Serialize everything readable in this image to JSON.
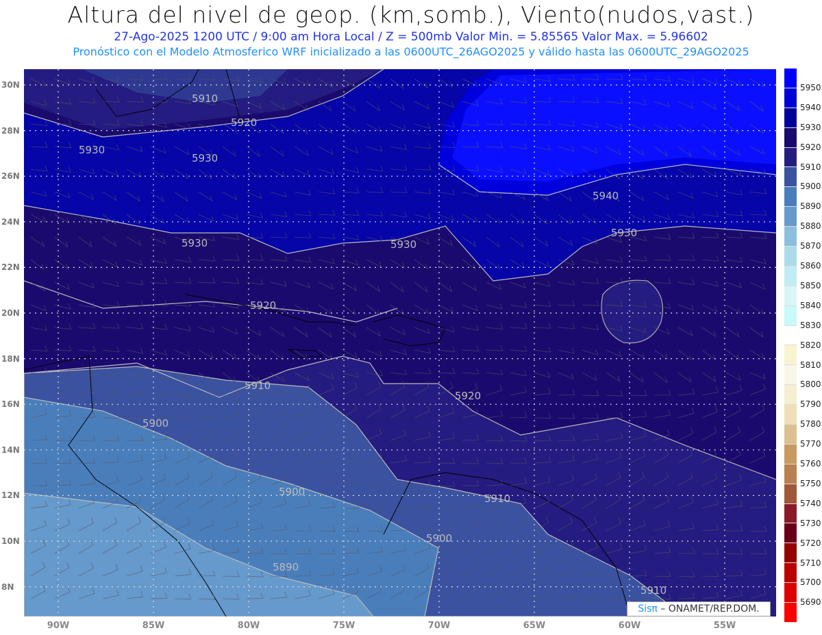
{
  "header": {
    "title": "Altura del nivel de geop. (km,somb.), Viento(nudos,vast.)",
    "line1": "27-Ago-2025  1200 UTC / 9:00 am Hora Local / Z = 500mb    Valor Min. = 5.85565  Valor Max. = 5.96602",
    "line2": "Pronóstico con el Modelo Atmosferico WRF inicializado a las 0600UTC_26AGO2025 y válido hasta las  0600UTC_29AGO2025"
  },
  "map": {
    "lat_labels": [
      "30N",
      "28N",
      "26N",
      "24N",
      "22N",
      "20N",
      "18N",
      "16N",
      "14N",
      "12N",
      "10N",
      "8N"
    ],
    "lon_labels": [
      "90W",
      "85W",
      "80W",
      "75W",
      "70W",
      "65W",
      "60W",
      "55W"
    ],
    "contour_labels": [
      "5910",
      "5920",
      "5930",
      "5930",
      "5930",
      "5930",
      "5940",
      "5930",
      "5920",
      "5910",
      "5920",
      "5900",
      "5900",
      "5910",
      "5900",
      "5890",
      "5910"
    ],
    "fill_colors": {
      "z5950": "#0000ff",
      "z5940": "#0000d8",
      "z5930": "#00009a",
      "z5920": "#1a0a6e",
      "z5910": "#241c80",
      "z5900": "#3a52a0",
      "z5890": "#4a7ebb",
      "z5880": "#6699cc"
    }
  },
  "colorbar": {
    "labels": [
      "5950",
      "5940",
      "5930",
      "5920",
      "5910",
      "5900",
      "5890",
      "5880",
      "5870",
      "5860",
      "5850",
      "5840",
      "5830",
      "5820",
      "5810",
      "5800",
      "5790",
      "5780",
      "5770",
      "5760",
      "5750",
      "5740",
      "5730",
      "5720",
      "5710",
      "5700",
      "5690"
    ],
    "colors": [
      "#0000ff",
      "#0000d8",
      "#00009a",
      "#1a0a6e",
      "#241c80",
      "#3a52a0",
      "#4a7ebb",
      "#6699cc",
      "#8bbfdd",
      "#acdcea",
      "#c2ecf3",
      "#daf5f8",
      "#c8f9fb",
      "#ffffff",
      "#f8f4d2",
      "#faf6e6",
      "#f6eed2",
      "#efdfb8",
      "#dcc090",
      "#c89a60",
      "#b98050",
      "#a0573a",
      "#8a1a28",
      "#6a0018",
      "#940000",
      "#bb0000",
      "#dd0000",
      "#ff0000"
    ]
  },
  "logo": {
    "sis": "Sisπ",
    "text": " –  ONAMET/REP.DOM."
  }
}
